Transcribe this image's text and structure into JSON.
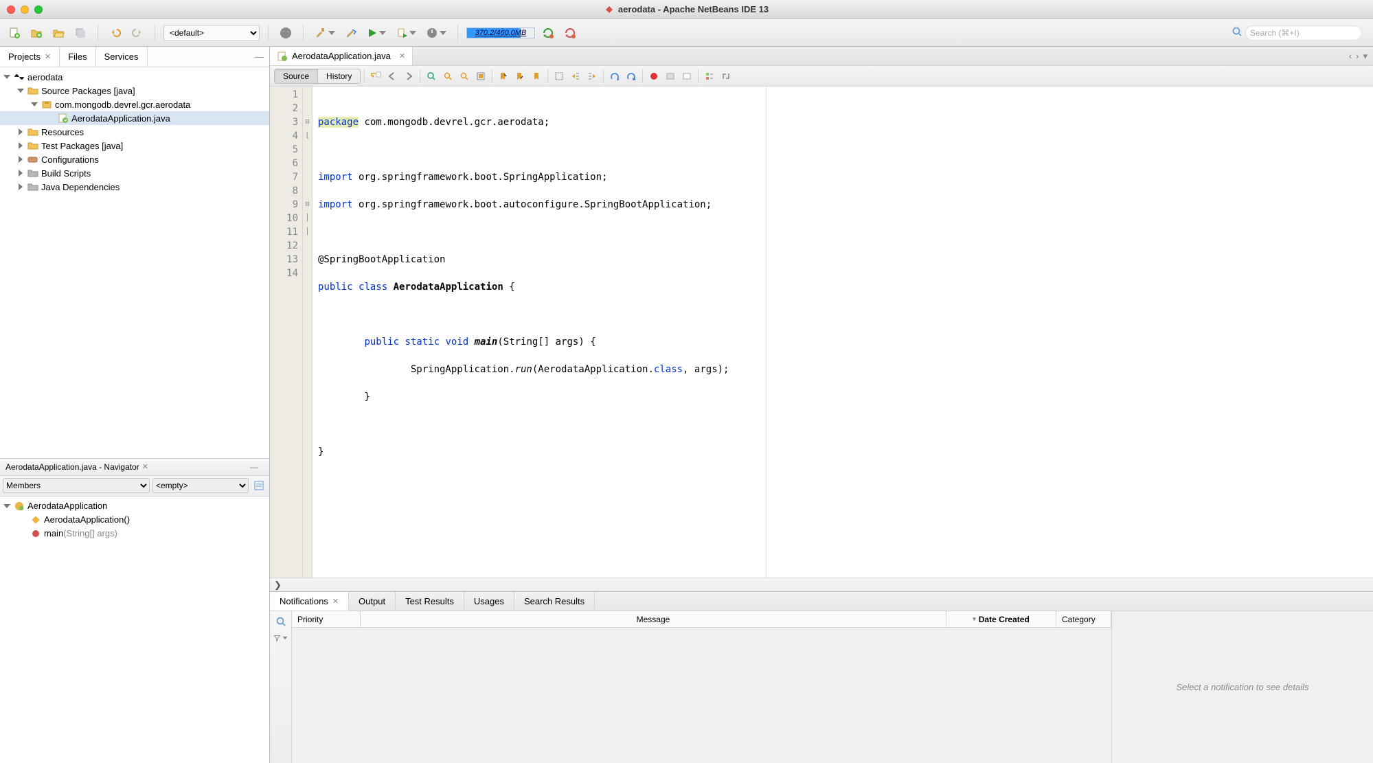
{
  "window": {
    "title": "aerodata - Apache NetBeans IDE 13"
  },
  "toolbar": {
    "config_selected": "<default>",
    "config_options": [
      "<default>"
    ],
    "memory": {
      "label": "370.2/460.0MB",
      "used_fraction": 0.8
    },
    "search_placeholder": "Search (⌘+I)"
  },
  "left_tabs": [
    {
      "label": "Projects",
      "closable": true,
      "active": true
    },
    {
      "label": "Files",
      "closable": false,
      "active": false
    },
    {
      "label": "Services",
      "closable": false,
      "active": false
    }
  ],
  "project_tree": {
    "root": {
      "label": "aerodata"
    },
    "src": {
      "label": "Source Packages [java]"
    },
    "pkg": {
      "label": "com.mongodb.devrel.gcr.aerodata"
    },
    "file": {
      "label": "AerodataApplication.java"
    },
    "others": [
      {
        "label": "Resources"
      },
      {
        "label": "Test Packages [java]"
      },
      {
        "label": "Configurations"
      },
      {
        "label": "Build Scripts"
      },
      {
        "label": "Java Dependencies"
      }
    ]
  },
  "navigator": {
    "title": "AerodataApplication.java - Navigator",
    "members_label": "Members",
    "filter_placeholder": "<empty>",
    "items": {
      "class": "AerodataApplication",
      "ctor": "AerodataApplication()",
      "main_name": "main",
      "main_args": "(String[] args)"
    }
  },
  "editor": {
    "tab_label": "AerodataApplication.java",
    "view_source": "Source",
    "view_history": "History",
    "line_numbers": [
      "1",
      "2",
      "3",
      "4",
      "5",
      "6",
      "7",
      "8",
      "9",
      "10",
      "11",
      "12",
      "13",
      "14"
    ],
    "code": {
      "l1a": "package",
      "l1b": " com.mongodb.devrel.gcr.aerodata;",
      "l3a": "import",
      "l3b": " org.springframework.boot.SpringApplication;",
      "l4a": "import",
      "l4b": " org.springframework.boot.autoconfigure.SpringBootApplication;",
      "l6": "@SpringBootApplication",
      "l7a": "public",
      "l7b": " ",
      "l7c": "class",
      "l7d": " ",
      "l7e": "AerodataApplication",
      "l7f": " {",
      "l9a": "        ",
      "l9b": "public",
      "l9c": " ",
      "l9d": "static",
      "l9e": " ",
      "l9f": "void",
      "l9g": " ",
      "l9h": "main",
      "l9i": "(String[] args) {",
      "l10a": "                SpringApplication.",
      "l10b": "run",
      "l10c": "(AerodataApplication.",
      "l10d": "class",
      "l10e": ", args);",
      "l11": "        }",
      "l13": "}"
    },
    "breadcrumb_arrow": "❯"
  },
  "bottom_tabs": [
    {
      "label": "Notifications",
      "closable": true,
      "active": true
    },
    {
      "label": "Output"
    },
    {
      "label": "Test Results"
    },
    {
      "label": "Usages"
    },
    {
      "label": "Search Results"
    }
  ],
  "notifications": {
    "columns": {
      "priority": "Priority",
      "message": "Message",
      "date": "Date Created",
      "category": "Category"
    },
    "details_placeholder": "Select a notification to see details"
  }
}
